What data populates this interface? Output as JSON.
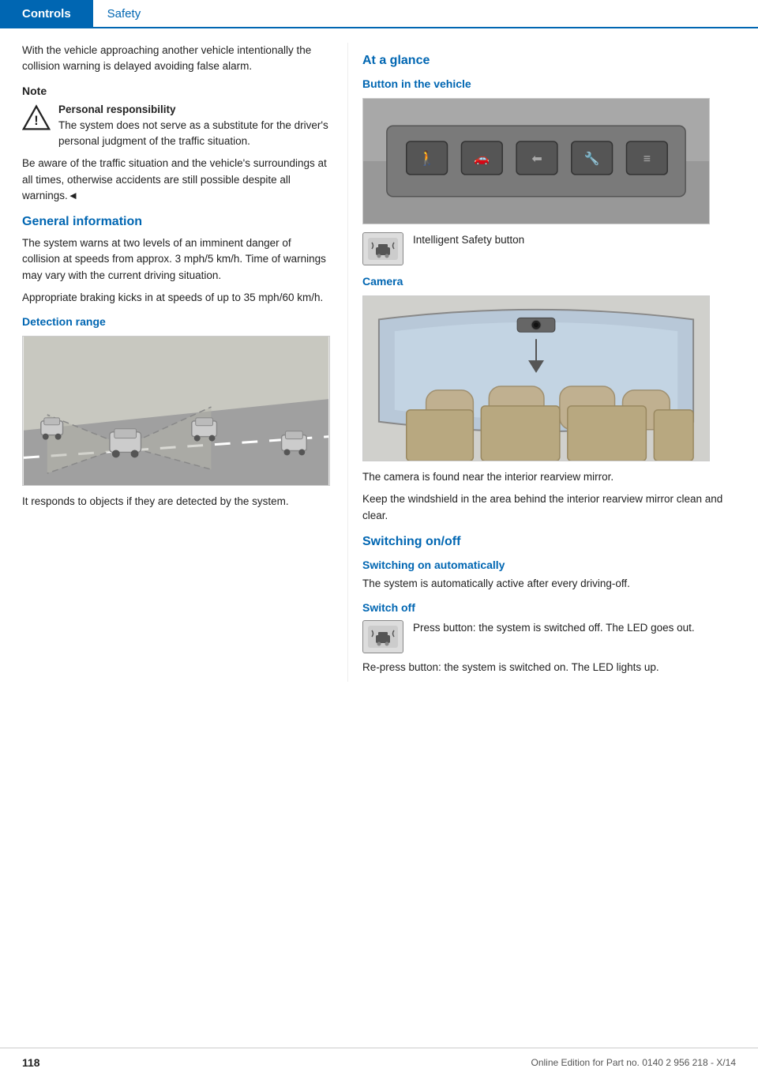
{
  "header": {
    "controls_label": "Controls",
    "safety_label": "Safety"
  },
  "left_col": {
    "opening_text": "With the vehicle approaching another vehicle intentionally the collision warning is delayed avoiding false alarm.",
    "note": {
      "label": "Note",
      "title": "Personal responsibility",
      "text": "The system does not serve as a substitute for the driver's personal judgment of the traffic situation.",
      "warning_text": "Be aware of the traffic situation and the vehicle's surroundings at all times, otherwise accidents are still possible despite all warnings.◄"
    },
    "general_information": {
      "heading": "General information",
      "text1": "The system warns at two levels of an imminent danger of collision at speeds from approx. 3 mph/5 km/h. Time of warnings may vary with the current driving situation.",
      "text2": "Appropriate braking kicks in at speeds of up to 35 mph/60 km/h."
    },
    "detection_range": {
      "heading": "Detection range",
      "text": "It responds to objects if they are detected by the system."
    }
  },
  "right_col": {
    "at_a_glance": {
      "heading": "At a glance"
    },
    "button_in_vehicle": {
      "heading": "Button in the vehicle"
    },
    "intelligent_safety": {
      "label": "Intelligent Safety button"
    },
    "camera": {
      "heading": "Camera",
      "text1": "The camera is found near the interior rearview mirror.",
      "text2": "Keep the windshield in the area behind the interior rearview mirror clean and clear."
    },
    "switching_on_off": {
      "heading": "Switching on/off"
    },
    "switching_automatically": {
      "subheading": "Switching on automatically",
      "text": "The system is automatically active after every driving-off."
    },
    "switch_off": {
      "subheading": "Switch off",
      "text1": "Press button: the system is switched off. The LED goes out.",
      "text2": "Re-press button: the system is switched on. The LED lights up."
    }
  },
  "footer": {
    "page_number": "118",
    "edition_text": "Online Edition for Part no. 0140 2 956 218 - X/14"
  }
}
